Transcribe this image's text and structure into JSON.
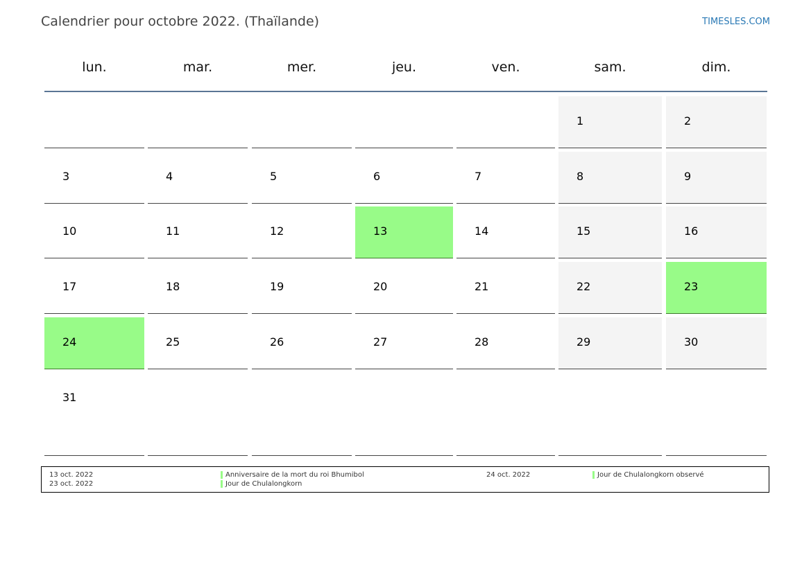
{
  "header": {
    "title": "Calendrier pour octobre 2022. (Thaïlande)",
    "site": "TIMESLES.COM"
  },
  "weekdays": [
    "lun.",
    "mar.",
    "mer.",
    "jeu.",
    "ven.",
    "sam.",
    "dim."
  ],
  "weeks": [
    [
      "",
      "",
      "",
      "",
      "",
      "1",
      "2"
    ],
    [
      "3",
      "4",
      "5",
      "6",
      "7",
      "8",
      "9"
    ],
    [
      "10",
      "11",
      "12",
      "13",
      "14",
      "15",
      "16"
    ],
    [
      "17",
      "18",
      "19",
      "20",
      "21",
      "22",
      "23"
    ],
    [
      "24",
      "25",
      "26",
      "27",
      "28",
      "29",
      "30"
    ],
    [
      "31",
      "",
      "",
      "",
      "",
      "",
      ""
    ]
  ],
  "holiday_days": [
    "13",
    "23",
    "24"
  ],
  "colors": {
    "holiday": "#98fb88",
    "weekend": "#f4f4f4",
    "header_rule": "#5a7594",
    "site_link": "#2a79b5"
  },
  "legend": [
    {
      "date": "13 oct. 2022",
      "name": "Anniversaire de la mort du roi Bhumibol"
    },
    {
      "date": "23 oct. 2022",
      "name": "Jour de Chulalongkorn"
    },
    {
      "date": "24 oct. 2022",
      "name": "Jour de Chulalongkorn observé"
    }
  ]
}
